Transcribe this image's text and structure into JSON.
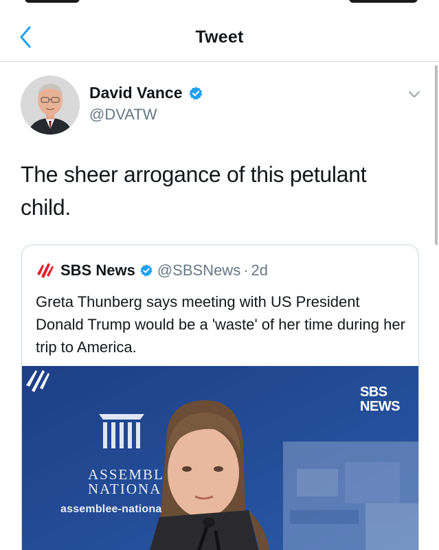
{
  "nav": {
    "title": "Tweet",
    "back_icon": "chevron-left-icon"
  },
  "tweet": {
    "author_name": "David Vance",
    "author_handle": "@DVATW",
    "text": "The sheer arrogance of this petulant child.",
    "more_icon": "chevron-down-icon"
  },
  "quote": {
    "name": "SBS News",
    "handle": "@SBSNews",
    "separator": "·",
    "time": "2d",
    "text": "Greta Thunberg says meeting with US President Donald Trump would be a 'waste' of her time during her trip to America.",
    "media": {
      "watermark_line1": "SBS",
      "watermark_line2": "NEWS",
      "backdrop_line1": "ASSEMBL",
      "backdrop_line2": "NATIONA",
      "backdrop_url": "assemblee-nationa"
    }
  },
  "colors": {
    "accent": "#1da1f2",
    "verified": "#1da1f2",
    "secondary_text": "#657786",
    "border": "#ccd6dd",
    "sbs_red": "#e4202b"
  }
}
